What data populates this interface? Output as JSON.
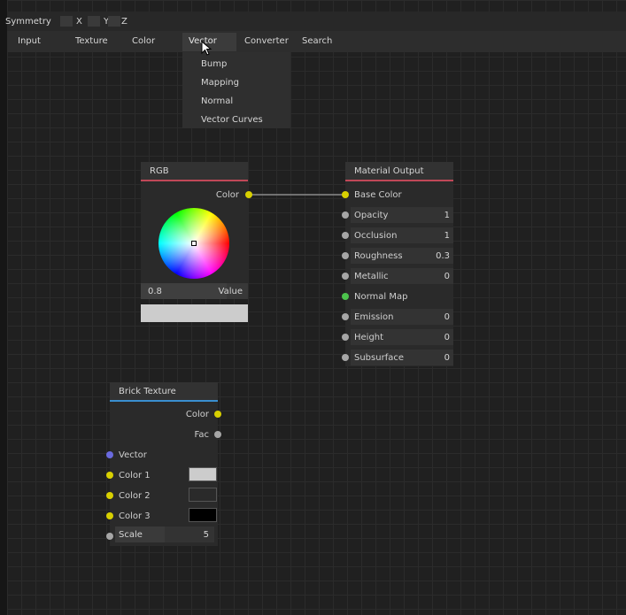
{
  "symmetry": {
    "label": "Symmetry",
    "x": "X",
    "y": "Y",
    "z": "Z"
  },
  "menu": {
    "items": [
      "Input",
      "Texture",
      "Color",
      "Vector",
      "Converter",
      "Search"
    ],
    "active": "Vector"
  },
  "dropdown": {
    "items": [
      "Bump",
      "Mapping",
      "Normal",
      "Vector Curves"
    ]
  },
  "rgb_node": {
    "title": "RGB",
    "output": "Color",
    "value": "0.8",
    "value_label": "Value",
    "value_fraction": 0.8,
    "accent": "#c04858",
    "color_swatch": "#cccccc"
  },
  "material_node": {
    "title": "Material Output",
    "accent": "#c04858",
    "inputs": [
      {
        "label": "Base Color",
        "value": "",
        "socket": "#d8d000"
      },
      {
        "label": "Opacity",
        "value": "1",
        "socket": "#a6a6a6"
      },
      {
        "label": "Occlusion",
        "value": "1",
        "socket": "#a6a6a6"
      },
      {
        "label": "Roughness",
        "value": "0.3",
        "socket": "#a6a6a6"
      },
      {
        "label": "Metallic",
        "value": "0",
        "socket": "#a6a6a6"
      },
      {
        "label": "Normal Map",
        "value": "",
        "socket": "#4cc34c"
      },
      {
        "label": "Emission",
        "value": "0",
        "socket": "#a6a6a6"
      },
      {
        "label": "Height",
        "value": "0",
        "socket": "#a6a6a6"
      },
      {
        "label": "Subsurface",
        "value": "0",
        "socket": "#a6a6a6"
      }
    ]
  },
  "brick_node": {
    "title": "Brick Texture",
    "accent": "#3a8fd0",
    "outputs": [
      "Color",
      "Fac"
    ],
    "vector": "Vector",
    "color1": "Color 1",
    "color2": "Color 2",
    "color3": "Color 3",
    "scale_label": "Scale",
    "scale_value": "5",
    "color1_swatch": "#cccccc",
    "color2_swatch": "#2a2a2a",
    "color3_swatch": "#000000"
  }
}
